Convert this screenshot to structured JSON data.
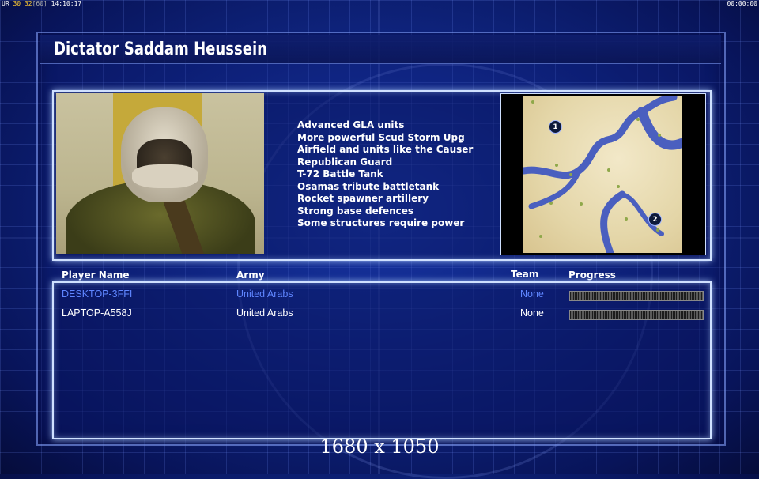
{
  "status": {
    "left": [
      "UR",
      "30",
      "32",
      "[60]",
      "14:10:17"
    ],
    "right": "00:00:00"
  },
  "title": "Dictator Saddam Heussein",
  "features": [
    "Advanced GLA units",
    "More powerful Scud Storm Upg",
    "Airfield and units like the Causer",
    "Republican Guard",
    "T-72 Battle Tank",
    "Osamas tribute battletank",
    "Rocket spawner artillery",
    "Strong base defences",
    "Some structures require power"
  ],
  "minimap": {
    "start_positions": [
      "1",
      "2"
    ]
  },
  "players": {
    "headers": {
      "name": "Player Name",
      "army": "Army",
      "team": "Team",
      "progress": "Progress"
    },
    "rows": [
      {
        "name": "DESKTOP-3FFI",
        "army": "United Arabs",
        "team": "None",
        "active": true
      },
      {
        "name": "LAPTOP-A558J",
        "army": "United Arabs",
        "team": "None",
        "active": false
      }
    ]
  },
  "resolution": "1680 x 1050",
  "colors": {
    "background": "#0f2580",
    "highlight_text": "#5f86ff",
    "panel_border": "#cfe0ff"
  }
}
